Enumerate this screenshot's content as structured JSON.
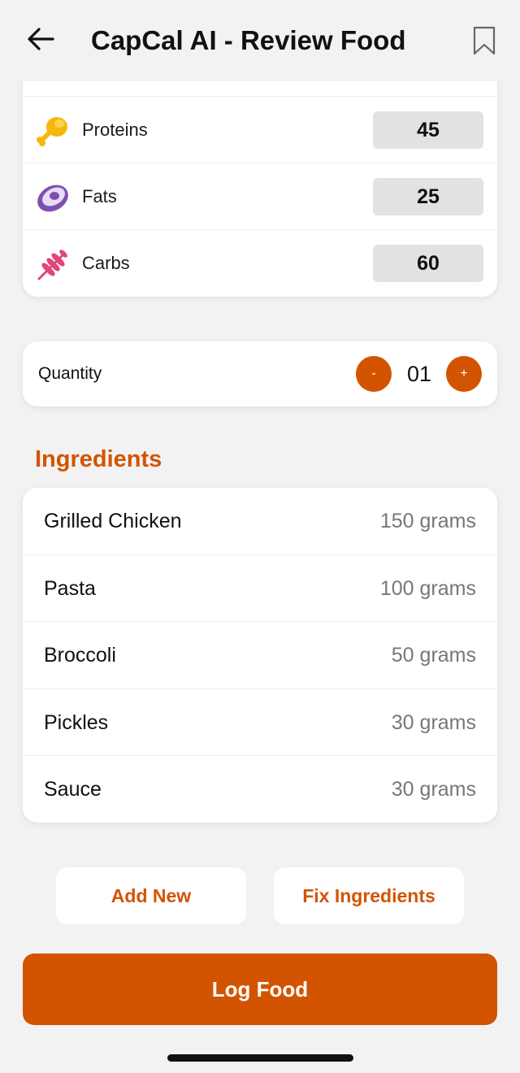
{
  "header": {
    "title": "CapCal AI - Review Food"
  },
  "icons": {
    "back": "arrow-left-icon",
    "bookmark": "bookmark-icon",
    "proteins": "chicken-leg-icon",
    "fats": "avocado-icon",
    "carbs": "wheat-icon"
  },
  "macros": [
    {
      "label": "Proteins",
      "value": "45"
    },
    {
      "label": "Fats",
      "value": "25"
    },
    {
      "label": "Carbs",
      "value": "60"
    }
  ],
  "quantity": {
    "label": "Quantity",
    "minus_label": "-",
    "value": "01",
    "plus_label": "+"
  },
  "ingredients": {
    "heading": "Ingredients",
    "items": [
      {
        "name": "Grilled Chicken",
        "amount": "150 grams"
      },
      {
        "name": "Pasta",
        "amount": "100 grams"
      },
      {
        "name": "Broccoli",
        "amount": "50 grams"
      },
      {
        "name": "Pickles",
        "amount": "30 grams"
      },
      {
        "name": "Sauce",
        "amount": "30 grams"
      }
    ]
  },
  "actions": {
    "add_new": "Add New",
    "fix_ingredients": "Fix Ingredients",
    "log_food": "Log Food"
  },
  "colors": {
    "accent": "#d35400",
    "background": "#f2f2f2",
    "value_box": "#e2e2e2"
  }
}
